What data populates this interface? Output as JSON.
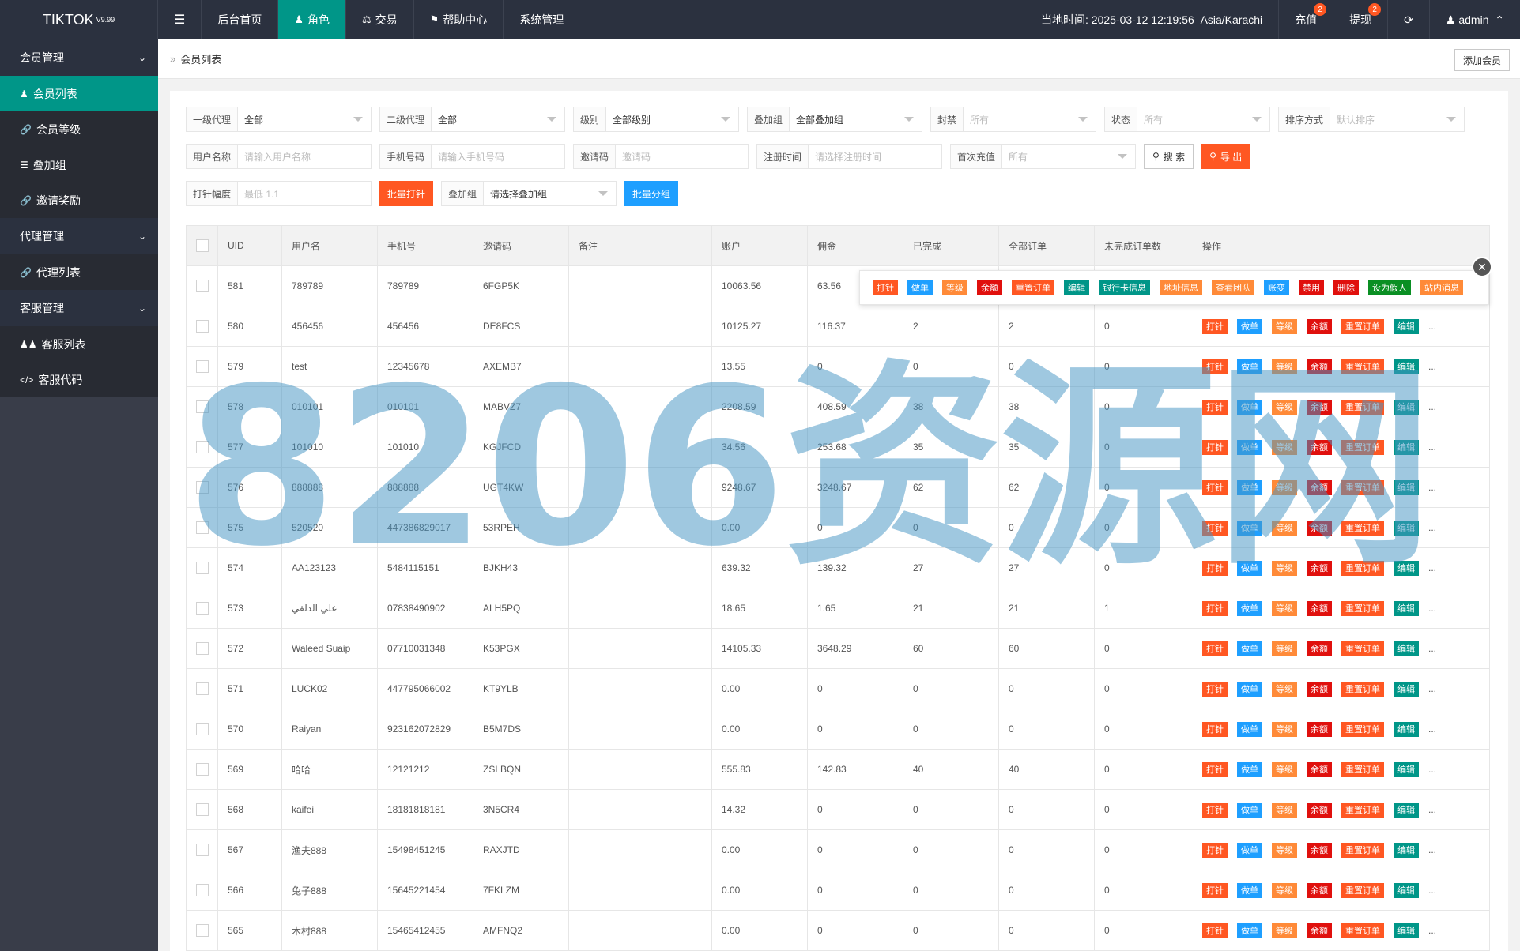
{
  "topbar": {
    "logo": "TIKTOK",
    "version": "V9.99",
    "nav": [
      {
        "label": "后台首页",
        "icon": ""
      },
      {
        "label": "角色",
        "icon": "user-icon"
      },
      {
        "label": "交易",
        "icon": "scale-icon"
      },
      {
        "label": "帮助中心",
        "icon": "flag-icon"
      },
      {
        "label": "系统管理",
        "icon": ""
      }
    ],
    "time_label": "当地时间: 2025-03-12 12:19:56",
    "timezone": "Asia/Karachi",
    "recharge": "充值",
    "recharge_badge": "2",
    "withdraw": "提现",
    "withdraw_badge": "2",
    "refresh_icon": "refresh-icon",
    "user": "admin"
  },
  "sidebar": {
    "groups": [
      {
        "label": "会员管理",
        "items": [
          {
            "label": "会员列表",
            "icon": "user-icon"
          },
          {
            "label": "会员等级",
            "icon": "link-icon"
          },
          {
            "label": "叠加组",
            "icon": "list-icon"
          },
          {
            "label": "邀请奖励",
            "icon": "link-icon"
          }
        ]
      },
      {
        "label": "代理管理",
        "items": [
          {
            "label": "代理列表",
            "icon": "link-icon"
          }
        ]
      },
      {
        "label": "客服管理",
        "items": [
          {
            "label": "客服列表",
            "icon": "users-icon"
          },
          {
            "label": "客服代码",
            "icon": "code-icon"
          }
        ]
      }
    ]
  },
  "breadcrumb": {
    "current": "会员列表"
  },
  "add_member": "添加会员",
  "filters": {
    "row1": [
      {
        "label": "一级代理",
        "value": "全部",
        "ph": false
      },
      {
        "label": "二级代理",
        "value": "全部",
        "ph": false
      },
      {
        "label": "级别",
        "value": "全部级别",
        "ph": false
      },
      {
        "label": "叠加组",
        "value": "全部叠加组",
        "ph": false
      },
      {
        "label": "封禁",
        "value": "所有",
        "ph": true
      },
      {
        "label": "状态",
        "value": "所有",
        "ph": true
      },
      {
        "label": "排序方式",
        "value": "默认排序",
        "ph": true
      }
    ],
    "row2": [
      {
        "label": "用户名称",
        "value": "请输入用户名称"
      },
      {
        "label": "手机号码",
        "value": "请输入手机号码"
      },
      {
        "label": "邀请码",
        "value": "邀请码"
      },
      {
        "label": "注册时间",
        "value": "请选择注册时间"
      },
      {
        "label": "首次充值",
        "value": "所有"
      }
    ],
    "search": "搜 索",
    "export": "导 出",
    "row3": {
      "range_label": "打针幅度",
      "range_ph": "最低 1.1",
      "batch_inject": "批量打针",
      "group_label": "叠加组",
      "group_value": "请选择叠加组",
      "batch_group": "批量分组"
    }
  },
  "table": {
    "headers": [
      "UID",
      "用户名",
      "手机号",
      "邀请码",
      "备注",
      "账户",
      "佣金",
      "已完成",
      "全部订单",
      "未完成订单数",
      "操作"
    ],
    "rows": [
      {
        "uid": "581",
        "user": "789789",
        "phone": "789789",
        "inv": "6FGP5K",
        "note": "",
        "acc": "10063.56",
        "com": "63.56",
        "done": "",
        "all": "",
        "undone": ""
      },
      {
        "uid": "580",
        "user": "456456",
        "phone": "456456",
        "inv": "DE8FCS",
        "note": "",
        "acc": "10125.27",
        "com": "116.37",
        "done": "2",
        "all": "2",
        "undone": "0"
      },
      {
        "uid": "579",
        "user": "test",
        "phone": "12345678",
        "inv": "AXEMB7",
        "note": "",
        "acc": "13.55",
        "com": "0",
        "done": "0",
        "all": "0",
        "undone": "0"
      },
      {
        "uid": "578",
        "user": "010101",
        "phone": "010101",
        "inv": "MABVZ7",
        "note": "",
        "acc": "2208.59",
        "com": "408.59",
        "done": "38",
        "all": "38",
        "undone": "0"
      },
      {
        "uid": "577",
        "user": "101010",
        "phone": "101010",
        "inv": "KGJFCD",
        "note": "",
        "acc": "34.56",
        "com": "253.68",
        "done": "35",
        "all": "35",
        "undone": "0"
      },
      {
        "uid": "576",
        "user": "888888",
        "phone": "888888",
        "inv": "UGT4KW",
        "note": "",
        "acc": "9248.67",
        "com": "3248.67",
        "done": "62",
        "all": "62",
        "undone": "0"
      },
      {
        "uid": "575",
        "user": "520520",
        "phone": "447386829017",
        "inv": "53RPEH",
        "note": "",
        "acc": "0.00",
        "com": "0",
        "done": "0",
        "all": "0",
        "undone": "0"
      },
      {
        "uid": "574",
        "user": "AA123123",
        "phone": "5484115151",
        "inv": "BJKH43",
        "note": "",
        "acc": "639.32",
        "com": "139.32",
        "done": "27",
        "all": "27",
        "undone": "0"
      },
      {
        "uid": "573",
        "user": "علي الدلفي",
        "phone": "07838490902",
        "inv": "ALH5PQ",
        "note": "",
        "acc": "18.65",
        "com": "1.65",
        "done": "21",
        "all": "21",
        "undone": "1"
      },
      {
        "uid": "572",
        "user": "Waleed Suaip",
        "phone": "07710031348",
        "inv": "K53PGX",
        "note": "",
        "acc": "14105.33",
        "com": "3648.29",
        "done": "60",
        "all": "60",
        "undone": "0"
      },
      {
        "uid": "571",
        "user": "LUCK02",
        "phone": "447795066002",
        "inv": "KT9YLB",
        "note": "",
        "acc": "0.00",
        "com": "0",
        "done": "0",
        "all": "0",
        "undone": "0"
      },
      {
        "uid": "570",
        "user": "Raiyan",
        "phone": "923162072829",
        "inv": "B5M7DS",
        "note": "",
        "acc": "0.00",
        "com": "0",
        "done": "0",
        "all": "0",
        "undone": "0"
      },
      {
        "uid": "569",
        "user": "哈哈",
        "phone": "12121212",
        "inv": "ZSLBQN",
        "note": "",
        "acc": "555.83",
        "com": "142.83",
        "done": "40",
        "all": "40",
        "undone": "0"
      },
      {
        "uid": "568",
        "user": "kaifei",
        "phone": "18181818181",
        "inv": "3N5CR4",
        "note": "",
        "acc": "14.32",
        "com": "0",
        "done": "0",
        "all": "0",
        "undone": "0"
      },
      {
        "uid": "567",
        "user": "渔夫888",
        "phone": "15498451245",
        "inv": "RAXJTD",
        "note": "",
        "acc": "0.00",
        "com": "0",
        "done": "0",
        "all": "0",
        "undone": "0"
      },
      {
        "uid": "566",
        "user": "兔子888",
        "phone": "15645221454",
        "inv": "7FKLZM",
        "note": "",
        "acc": "0.00",
        "com": "0",
        "done": "0",
        "all": "0",
        "undone": "0"
      },
      {
        "uid": "565",
        "user": "木村888",
        "phone": "15465412455",
        "inv": "AMFNQ2",
        "note": "",
        "acc": "0.00",
        "com": "0",
        "done": "0",
        "all": "0",
        "undone": "0"
      }
    ],
    "row_ops": [
      {
        "label": "打针",
        "color": "o-orange"
      },
      {
        "label": "做单",
        "color": "o-blue"
      },
      {
        "label": "等级",
        "color": "o-amber"
      },
      {
        "label": "余额",
        "color": "o-red"
      },
      {
        "label": "重置订单",
        "color": "o-orange"
      },
      {
        "label": "编辑",
        "color": "o-green"
      }
    ],
    "more": "..."
  },
  "popup_ops": [
    {
      "label": "打针",
      "color": "o-orange"
    },
    {
      "label": "做单",
      "color": "o-blue"
    },
    {
      "label": "等级",
      "color": "o-amber"
    },
    {
      "label": "余额",
      "color": "o-red"
    },
    {
      "label": "重置订单",
      "color": "o-orange"
    },
    {
      "label": "编辑",
      "color": "o-green"
    },
    {
      "label": "银行卡信息",
      "color": "o-green"
    },
    {
      "label": "地址信息",
      "color": "o-amber"
    },
    {
      "label": "查看团队",
      "color": "o-amber"
    },
    {
      "label": "账变",
      "color": "o-blue"
    },
    {
      "label": "禁用",
      "color": "o-red"
    },
    {
      "label": "删除",
      "color": "o-red"
    },
    {
      "label": "设为假人",
      "color": "o-dgreen"
    },
    {
      "label": "站内消息",
      "color": "o-amber"
    }
  ],
  "watermark": "8206资源网",
  "colors": {
    "accent": "#009688",
    "topbar": "#2b313f",
    "sidebar": "#393d49",
    "orange": "#ff5722",
    "blue": "#1e9fff",
    "red": "#e0100d"
  }
}
